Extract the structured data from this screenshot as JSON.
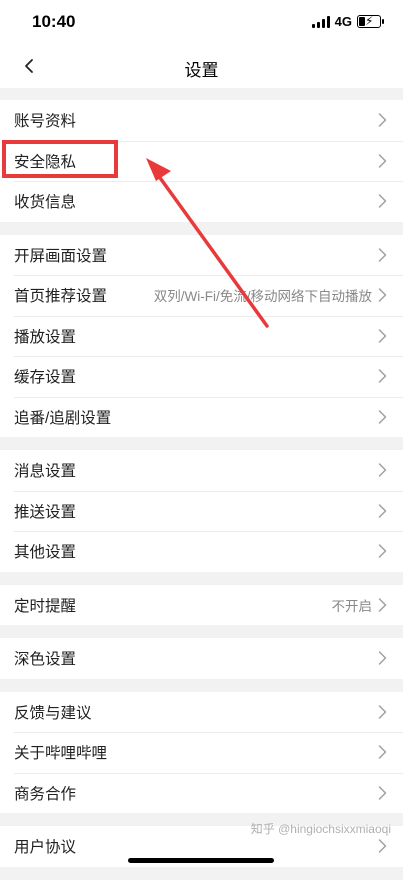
{
  "status_bar": {
    "time": "10:40",
    "network": "4G"
  },
  "nav": {
    "title": "设置"
  },
  "groups": [
    {
      "rows": [
        {
          "label": "账号资料"
        },
        {
          "label": "安全隐私"
        },
        {
          "label": "收货信息"
        }
      ]
    },
    {
      "rows": [
        {
          "label": "开屏画面设置"
        },
        {
          "label": "首页推荐设置",
          "value": "双列/Wi-Fi/免流/移动网络下自动播放"
        },
        {
          "label": "播放设置"
        },
        {
          "label": "缓存设置"
        },
        {
          "label": "追番/追剧设置"
        }
      ]
    },
    {
      "rows": [
        {
          "label": "消息设置"
        },
        {
          "label": "推送设置"
        },
        {
          "label": "其他设置"
        }
      ]
    },
    {
      "rows": [
        {
          "label": "定时提醒",
          "value": "不开启"
        }
      ]
    },
    {
      "rows": [
        {
          "label": "深色设置"
        }
      ]
    },
    {
      "rows": [
        {
          "label": "反馈与建议"
        },
        {
          "label": "关于哔哩哔哩"
        },
        {
          "label": "商务合作"
        }
      ]
    },
    {
      "rows": [
        {
          "label": "用户协议"
        }
      ]
    }
  ],
  "watermark": "知乎 @hingiochsixxmiaoqi",
  "annotation": {
    "color": "#e83a3a"
  }
}
